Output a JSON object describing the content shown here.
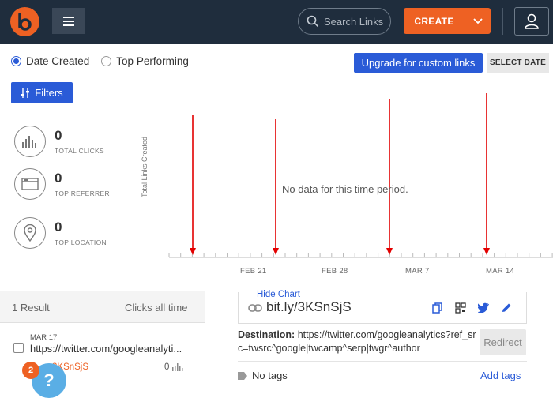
{
  "header": {
    "search_placeholder": "Search Links",
    "create_label": "CREATE"
  },
  "controls": {
    "radio_date_created": "Date Created",
    "radio_top_performing": "Top Performing",
    "selected": "Date Created",
    "upgrade_label": "Upgrade for custom links",
    "select_date_label": "SELECT DATE",
    "filters_label": "Filters"
  },
  "stats": [
    {
      "value": "0",
      "label": "TOTAL CLICKS",
      "icon": "bar-chart-icon"
    },
    {
      "value": "0",
      "label": "TOP REFERRER",
      "icon": "browser-window-icon"
    },
    {
      "value": "0",
      "label": "TOP LOCATION",
      "icon": "location-pin-icon"
    }
  ],
  "chart": {
    "ylabel": "Total Links Created",
    "empty_message": "No data for this time period.",
    "tick_labels": [
      "FEB 21",
      "FEB 28",
      "MAR 7",
      "MAR 14"
    ],
    "annotation_color": "#e30000",
    "annotation_arrow_count": 4
  },
  "chart_data": {
    "type": "line",
    "title": "",
    "xlabel": "",
    "ylabel": "Total Links Created",
    "x": [
      "FEB 21",
      "FEB 28",
      "MAR 7",
      "MAR 14"
    ],
    "series": []
  },
  "hide_chart_label": "Hide Chart",
  "results": {
    "count_label": "1 Result",
    "sort_label": "Clicks all time",
    "items": [
      {
        "date": "MAR 17",
        "title": "https://twitter.com/googleanalyti...",
        "short": "bit.ly/3KSnSjS",
        "short_visible": "3KSnSjS",
        "clicks": "0"
      }
    ]
  },
  "detail": {
    "short_link": "bit.ly/3KSnSjS",
    "destination_label": "Destination:",
    "destination_url": "https://twitter.com/googleanalytics?ref_src=twsrc^google|twcamp^serp|twgr^author",
    "redirect_label": "Redirect",
    "tags_label": "No tags",
    "add_tags_label": "Add tags"
  },
  "notifications": {
    "badge_count": "2",
    "help_symbol": "?"
  },
  "colors": {
    "brand": "#ee6123",
    "header_bg": "#1f2d3d",
    "accent": "#2a5bd7"
  }
}
